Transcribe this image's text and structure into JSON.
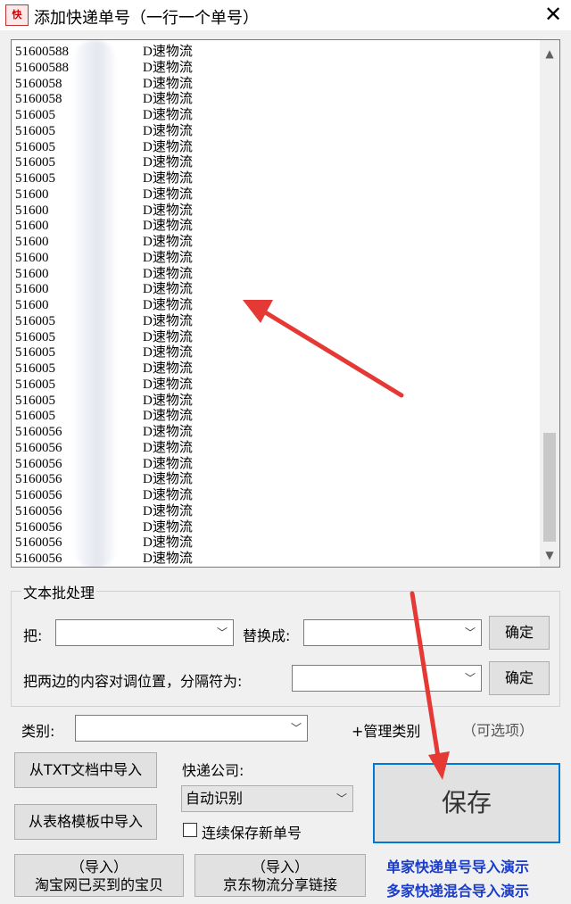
{
  "window": {
    "title": "添加快递单号（一行一个单号）",
    "icon_text": "快",
    "close": "✕"
  },
  "text_area": {
    "rows": [
      {
        "num": "51600588",
        "carrier": "D速物流"
      },
      {
        "num": "51600588",
        "carrier": "D速物流"
      },
      {
        "num": "5160058",
        "carrier": "D速物流"
      },
      {
        "num": "5160058",
        "carrier": "D速物流"
      },
      {
        "num": "516005",
        "carrier": "D速物流"
      },
      {
        "num": "516005",
        "carrier": "D速物流"
      },
      {
        "num": "516005",
        "carrier": "D速物流"
      },
      {
        "num": "516005",
        "carrier": "D速物流"
      },
      {
        "num": "516005",
        "carrier": "D速物流"
      },
      {
        "num": "51600",
        "carrier": "D速物流"
      },
      {
        "num": "51600",
        "carrier": "D速物流"
      },
      {
        "num": "51600",
        "carrier": "D速物流"
      },
      {
        "num": "51600",
        "carrier": "D速物流"
      },
      {
        "num": "51600",
        "carrier": "D速物流"
      },
      {
        "num": "51600",
        "carrier": "D速物流"
      },
      {
        "num": "51600",
        "carrier": "D速物流"
      },
      {
        "num": "51600",
        "carrier": "D速物流"
      },
      {
        "num": "516005",
        "carrier": "D速物流"
      },
      {
        "num": "516005",
        "carrier": "D速物流"
      },
      {
        "num": "516005",
        "carrier": "D速物流"
      },
      {
        "num": "516005",
        "carrier": "D速物流"
      },
      {
        "num": "516005",
        "carrier": "D速物流"
      },
      {
        "num": "516005",
        "carrier": "D速物流"
      },
      {
        "num": "516005",
        "carrier": "D速物流"
      },
      {
        "num": "5160056",
        "carrier": "D速物流"
      },
      {
        "num": "5160056",
        "carrier": "D速物流"
      },
      {
        "num": "5160056",
        "carrier": "D速物流"
      },
      {
        "num": "5160056",
        "carrier": "D速物流"
      },
      {
        "num": "5160056",
        "carrier": "D速物流"
      },
      {
        "num": "5160056",
        "carrier": "D速物流"
      },
      {
        "num": "5160056",
        "carrier": "D速物流"
      },
      {
        "num": "5160056",
        "carrier": "D速物流"
      },
      {
        "num": "5160056",
        "carrier": "D速物流"
      }
    ]
  },
  "batch": {
    "title": "文本批处理",
    "find_label": "把:",
    "find_value": "",
    "replace_label": "替换成:",
    "replace_value": "",
    "confirm1": "确定",
    "swap_label": "把两边的内容对调位置，分隔符为:",
    "swap_value": "",
    "confirm2": "确定"
  },
  "category": {
    "label": "类别:",
    "value": "",
    "manage": "+管理类别",
    "optional": "（可选项）"
  },
  "courier": {
    "label": "快递公司:",
    "value": "自动识别"
  },
  "import": {
    "txt": "从TXT文档中导入",
    "template": "从表格模板中导入",
    "taobao_line1": "（导入）",
    "taobao_line2": "淘宝网已买到的宝贝",
    "jd_line1": "（导入）",
    "jd_line2": "京东物流分享链接"
  },
  "continuous_save": "连续保存新单号",
  "save": "保存",
  "demo_links": [
    "单家快递单号导入演示",
    "多家快递混合导入演示"
  ],
  "colors": {
    "accent": "#0078d7",
    "arrow": "#e53935",
    "link": "#1a3cc8"
  }
}
